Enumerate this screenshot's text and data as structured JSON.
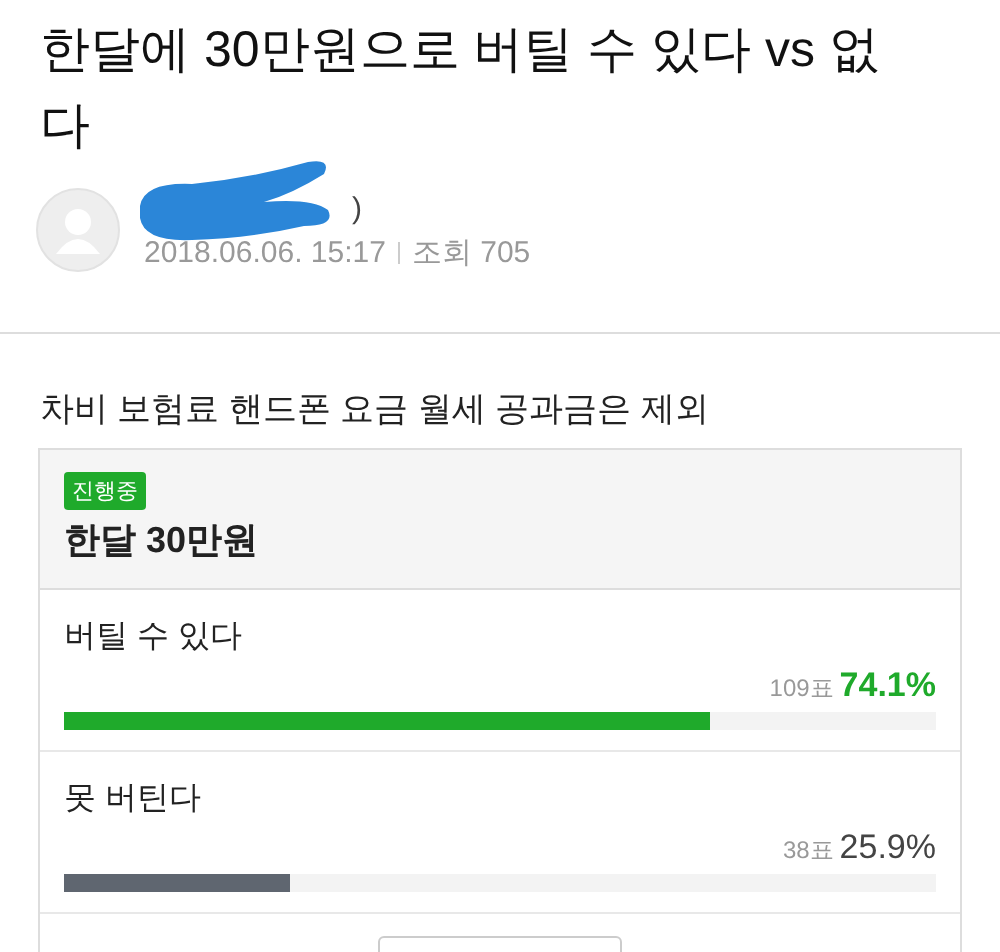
{
  "post": {
    "title": "한달에 30만원으로 버틸 수 있다 vs 없다",
    "author": {
      "name": ")",
      "redacted": true
    },
    "date": "2018.06.06. 15:17",
    "views_label": "조회",
    "views": "705",
    "body": "차비 보험료 핸드폰 요금 월세 공과금은 제외"
  },
  "poll": {
    "status": "진행중",
    "title": "한달 30만원",
    "options": [
      {
        "label": "버틸 수 있다",
        "votes": "109표",
        "percent": "74.1%",
        "level": 0.741,
        "leading": true
      },
      {
        "label": "못 버틴다",
        "votes": "38표",
        "percent": "25.9%",
        "level": 0.259,
        "leading": false
      }
    ]
  }
}
